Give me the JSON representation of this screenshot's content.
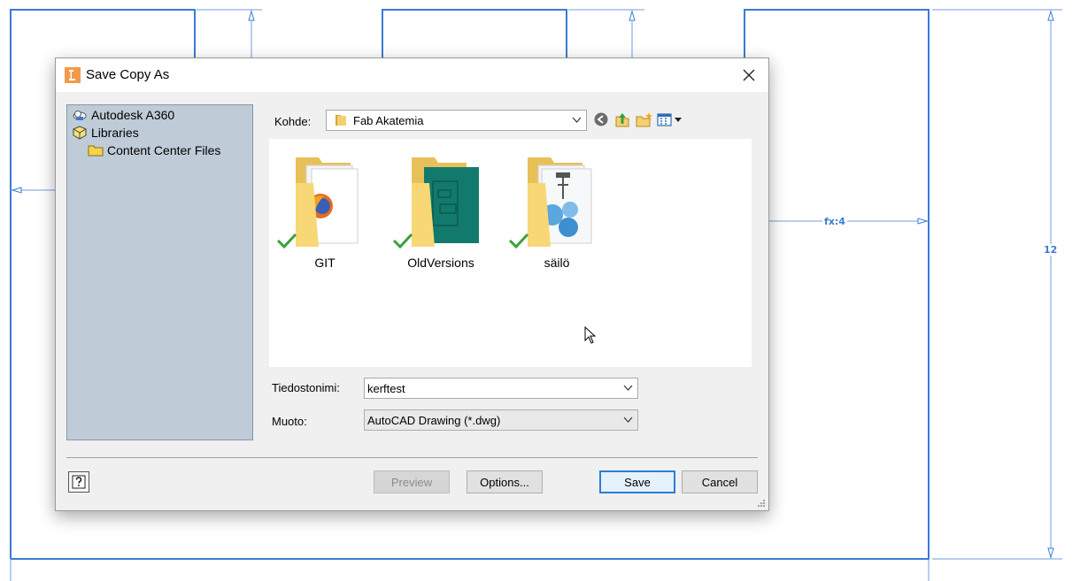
{
  "sketch": {
    "dimension_label": "fx:4",
    "height_label": "12",
    "line_color": "#3a7bd5"
  },
  "dialog": {
    "title": "Save Copy As",
    "app_icon": "inventor-app-icon",
    "close_icon": "close-icon"
  },
  "tree": {
    "items": [
      {
        "label": "Autodesk A360",
        "icon": "cloud-icon"
      },
      {
        "label": "Libraries",
        "icon": "libraries-icon"
      },
      {
        "label": "Content Center Files",
        "icon": "folder-icon"
      }
    ]
  },
  "location": {
    "label": "Kohde:",
    "value": "Fab Akatemia",
    "nav_icons": [
      "back-icon",
      "up-folder-icon",
      "new-folder-icon",
      "view-menu-icon"
    ]
  },
  "files": [
    {
      "name": "GIT",
      "status": "synced-check-icon"
    },
    {
      "name": "OldVersions",
      "status": "synced-check-icon"
    },
    {
      "name": "säilö",
      "status": "synced-check-icon"
    }
  ],
  "form": {
    "filename_label": "Tiedostonimi:",
    "filename_value": "kerftest",
    "format_label": "Muoto:",
    "format_value": "AutoCAD Drawing (*.dwg)"
  },
  "buttons": {
    "preview": "Preview",
    "options": "Options...",
    "save": "Save",
    "cancel": "Cancel"
  },
  "colors": {
    "accent": "#2f7cd3",
    "tree_bg": "#bfcbd7",
    "check": "#3aa13a"
  }
}
